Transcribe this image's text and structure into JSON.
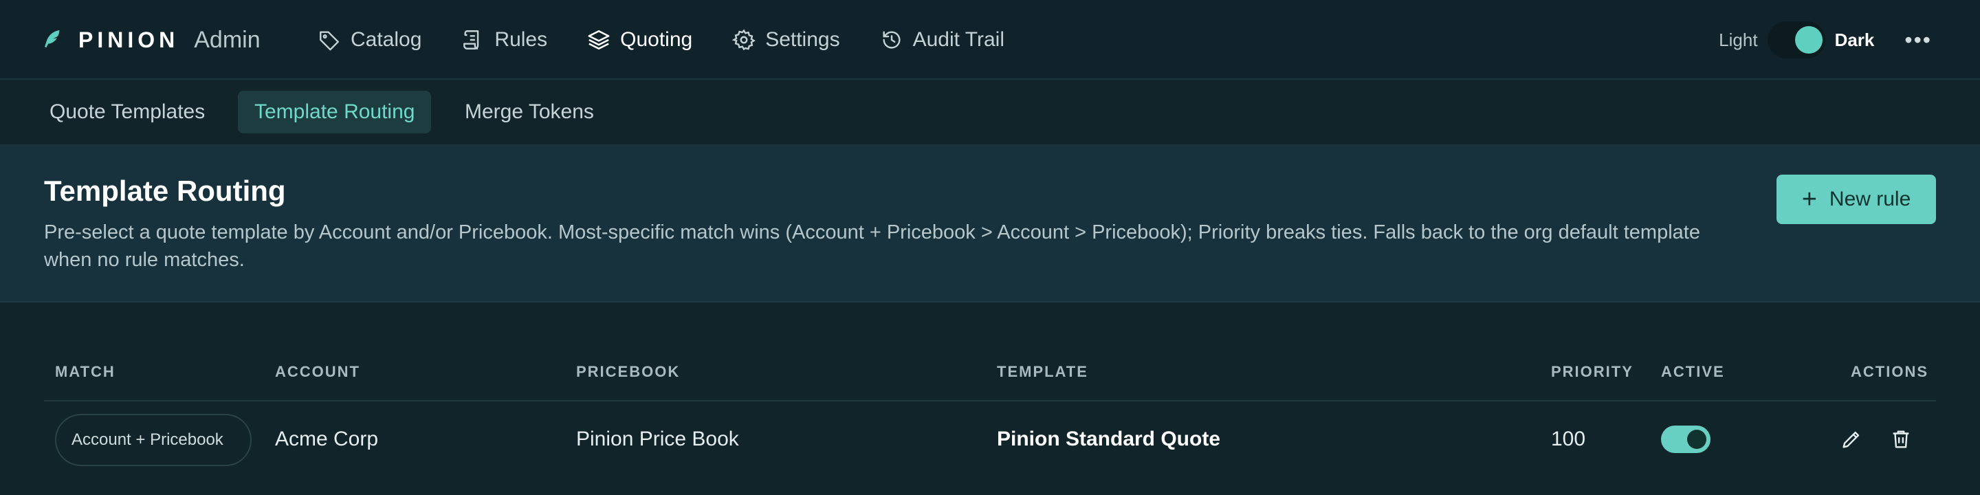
{
  "brand": {
    "name": "PINION",
    "sub": "Admin",
    "icon": "feather-icon"
  },
  "nav": [
    {
      "label": "Catalog",
      "icon": "tag-icon",
      "active": false
    },
    {
      "label": "Rules",
      "icon": "scroll-icon",
      "active": false
    },
    {
      "label": "Quoting",
      "icon": "layers-icon",
      "active": true
    },
    {
      "label": "Settings",
      "icon": "gear-icon",
      "active": false
    },
    {
      "label": "Audit Trail",
      "icon": "history-icon",
      "active": false
    }
  ],
  "theme": {
    "light_label": "Light",
    "dark_label": "Dark",
    "dark_on": true
  },
  "more_label": "•••",
  "subnav": [
    {
      "label": "Quote Templates",
      "active": false
    },
    {
      "label": "Template Routing",
      "active": true
    },
    {
      "label": "Merge Tokens",
      "active": false
    }
  ],
  "page": {
    "title": "Template Routing",
    "description": "Pre-select a quote template by Account and/or Pricebook. Most-specific match wins (Account + Pricebook > Account > Pricebook); Priority breaks ties. Falls back to the org default template when no rule matches.",
    "new_rule_label": "New rule"
  },
  "table": {
    "columns": [
      "MATCH",
      "ACCOUNT",
      "PRICEBOOK",
      "TEMPLATE",
      "PRIORITY",
      "ACTIVE",
      "ACTIONS"
    ],
    "rows": [
      {
        "match": "Account + Pricebook",
        "account": "Acme Corp",
        "pricebook": "Pinion Price Book",
        "template": "Pinion Standard Quote",
        "priority": "100",
        "active": true
      }
    ]
  },
  "colors": {
    "accent": "#67d0c2",
    "background": "#11242a",
    "banner": "#17323d",
    "active_tab_bg": "#1c3c3f"
  }
}
